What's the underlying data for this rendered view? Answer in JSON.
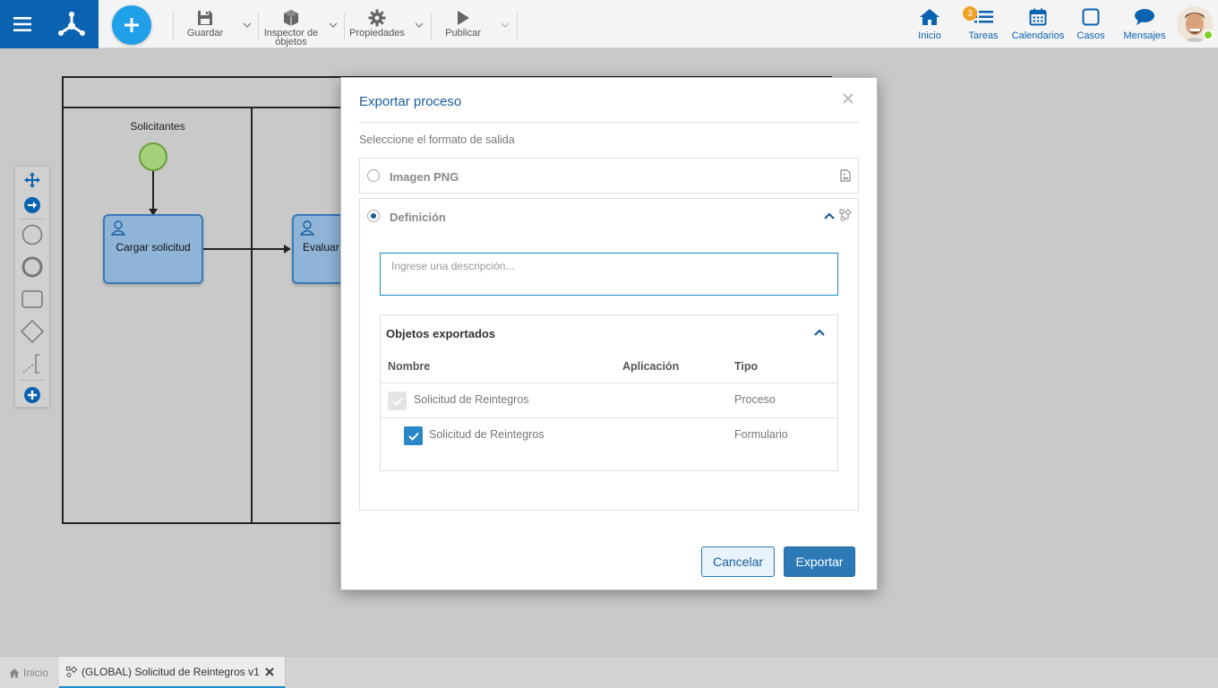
{
  "toolbar": {
    "guardar": "Guardar",
    "inspector_line1": "Inspector de",
    "inspector_line2": "objetos",
    "propiedades": "Propiedades",
    "publicar": "Publicar"
  },
  "nav": {
    "inicio": "Inicio",
    "tareas": "Tareas",
    "tareas_badge": "3",
    "calendarios": "Calendarios",
    "casos": "Casos",
    "mensajes": "Mensajes"
  },
  "diagram": {
    "lane_title": "Solicitantes",
    "task1": "Cargar solicitud",
    "task2": "Evaluar"
  },
  "modal": {
    "title": "Exportar proceso",
    "subtitle": "Seleccione el formato de salida",
    "option_png": "Imagen PNG",
    "option_def": "Definición",
    "description_placeholder": "Ingrese una descripción...",
    "objects_title": "Objetos exportados",
    "columns": [
      "Nombre",
      "Aplicación",
      "Tipo"
    ],
    "rows": [
      {
        "nombre": "Solicitud de Reintegros",
        "aplicacion": "",
        "tipo": "Proceso"
      },
      {
        "nombre": "Solicitud de Reintegros",
        "aplicacion": "",
        "tipo": "Formulario"
      }
    ],
    "cancel": "Cancelar",
    "export": "Exportar"
  },
  "tabs": {
    "home": "Inicio",
    "process": "(GLOBAL) Solicitud de Reintegros v1"
  },
  "colors": {
    "primary": "#0a63b0",
    "accent": "#1fa0e8",
    "button": "#2c79b5"
  }
}
